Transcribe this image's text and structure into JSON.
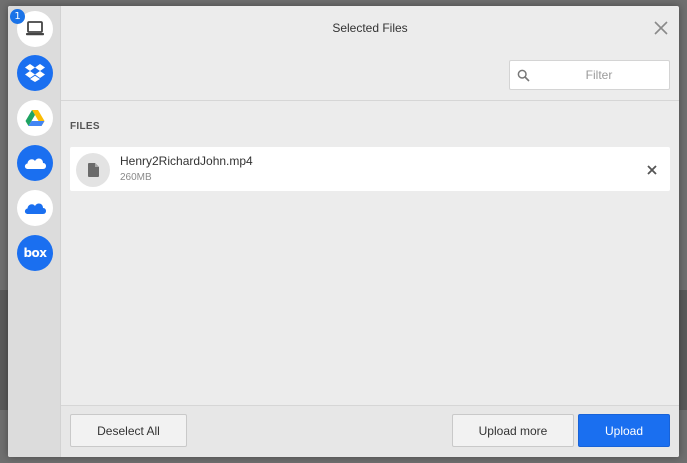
{
  "sidebar": {
    "items": [
      {
        "name": "My Device",
        "icon": "laptop-icon",
        "badge": "1"
      },
      {
        "name": "Dropbox",
        "icon": "dropbox-icon"
      },
      {
        "name": "Google Drive",
        "icon": "google-drive-icon"
      },
      {
        "name": "OneDrive",
        "icon": "onedrive-icon"
      },
      {
        "name": "OneDrive for Business",
        "icon": "onedrive-business-icon"
      },
      {
        "name": "Box",
        "icon": "box-icon",
        "label": "box"
      }
    ]
  },
  "header": {
    "title": "Selected Files",
    "close_icon": "close-icon"
  },
  "filter": {
    "placeholder": "Filter",
    "value": ""
  },
  "files_section": {
    "label": "FILES",
    "items": [
      {
        "name": "Henry2RichardJohn.mp4",
        "size": "260MB",
        "icon": "file-icon"
      }
    ]
  },
  "footer": {
    "deselect_label": "Deselect All",
    "upload_more_label": "Upload more",
    "upload_label": "Upload"
  },
  "colors": {
    "accent": "#1a6ff0",
    "sidebar_bg": "#dcdcdc",
    "modal_bg": "#ececec"
  }
}
